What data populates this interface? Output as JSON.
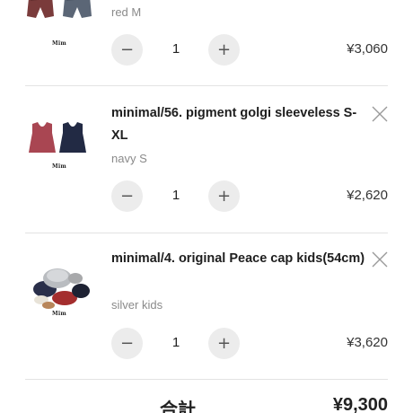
{
  "items": [
    {
      "title": "",
      "variant": "red M",
      "brand": "Mim",
      "quantity": "1",
      "price": "¥3,060",
      "minus_glyph": "−",
      "plus_glyph": "+"
    },
    {
      "title": "minimal/56. pigment golgi sleeveless S-XL",
      "variant": "navy S",
      "brand": "Mim",
      "quantity": "1",
      "price": "¥2,620",
      "minus_glyph": "−",
      "plus_glyph": "+",
      "remove_icon": "close-icon"
    },
    {
      "title": "minimal/4. original Peace cap kids(54cm)",
      "variant": "silver kids",
      "brand": "Mim",
      "quantity": "1",
      "price": "¥3,620",
      "minus_glyph": "−",
      "plus_glyph": "+",
      "remove_icon": "close-icon"
    }
  ],
  "total": {
    "label": "合計",
    "price": "¥9,300"
  },
  "colors": {
    "qty_button_bg": "#ececec",
    "variant_text": "#8a8a8a",
    "divider": "#e3e3e3"
  }
}
